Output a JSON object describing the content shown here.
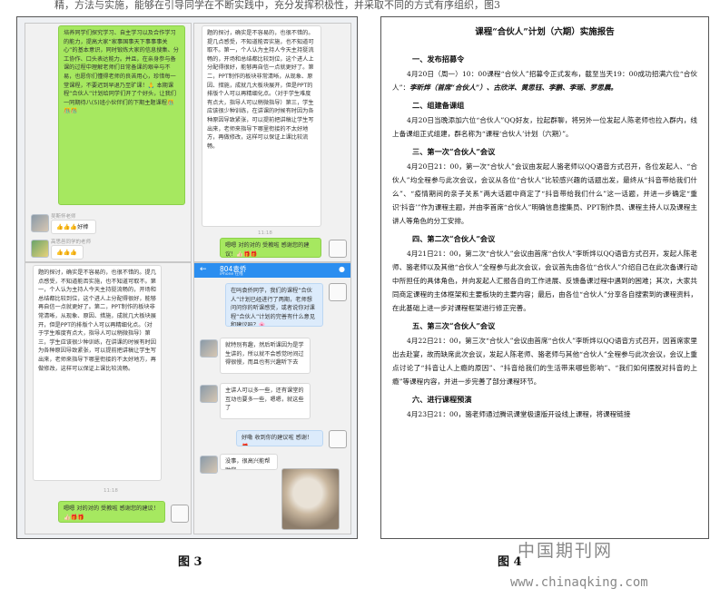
{
  "top_text": "精，方法与实施，能够在引导同学在不断实践中，充分发挥积极性，并采取不同的方式有序组织，图3",
  "figure3": {
    "caption": "图 3",
    "q1": {
      "main_bubble": "培养同学们探究学习、自主学习以及合作学习的能力，提高大家“家事国事天下事事事关心”的基本意识，同时锻炼大家的信息搜集、分工协作、口头表达能力。并且，在亲身参与备课的过程中理解老师们日常备课的艰辛与不易，也愿你们懂得老师的良苦用心，珍惜每一堂课程，不要迟到早退乃至旷课！🙏\n本期课程“合伙人”计划给同学们开了个好头，让我们一同期待八(5)班小伙伴们的下期主题课程🎊🎊🎊",
      "user1_name": "吴斯怀老师",
      "user1_msg": "👍👍👍好棒",
      "user2_name": "高思邑同学的老师",
      "user2_msg": "👍👍👍"
    },
    "q2": {
      "main_bubble": "题的探讨，确实是不容易的，也很不错的。提几点感受，不知道能否实施，也不知道可取不。第一，个人认为主持人今天主持挺流畅的，开场和总结都比较到位，这个进人上分配得很好，能够再自信一点就更好了。第二，PPT制作的板块非常清晰，从现象、原因、措施，成就几大板块展开，但是PPT的排版个人可以再精细化点。（对于学生难度有点大，指导人可以稍微指导）第三，学生应该很少种训练，在讲课的时候有时因为各种原因导致紧张，可以提前把讲稿让学生写出来，老师来指导下哪里衔接的不太好地方，再做修改，这样可以保证上课比较流畅。",
      "time": "11:18",
      "reply": "嗯嗯 对的对的 受教啦 感谢您的建议！👍🏻🎁🎁"
    },
    "q3": {
      "main_bubble": "题的探讨，确实是不容易的，也很不错的。提几点感受，不知道能否实施，也不知道可取不。第一，个人认为主持人今天主持挺流畅的，开场和总结都比较到位，这个进人上分配得很好，能够再自信一点就更好了。第二，PPT制作的板块非常清晰，从现象、原因、措施，成就几大板块展开，但是PPT的排版个人可以再精细化点。（对于学生难度有点大，指导人可以稍微指导）第三，学生应该很少种训练，在讲课的时候有时因为各种原因导致紧张，可以提前把讲稿让学生写出来，老师来指导下哪里衔接的不太好地方，再做修改，这样可以保证上课比较流畅。",
      "time": "11:18",
      "reply": "嗯嗯 对的对的 受教啦 感谢您的建议！👍🏻🎁🎁"
    },
    "q4": {
      "back_icon": "back-arrow-icon",
      "user_icon": "user-icon",
      "chat_title": "804袁侨",
      "chat_subtitle": "iPhone 在线",
      "msg1": "在吗袁侨同学，我们的课程“合伙人”计划已经进行了两期，老师想问问你的听课感受，或者说你对课程“合伙人”计划的完善有什么意见和建议吗？🌸",
      "msg2": "就特别有趣，然后听课因为是学生讲的，所以就不会感觉时间过得很慢，而且也有兴趣听下去",
      "msg3": "主讲人可以多一些，还有课堂的互动也要多一些，嗯嗯，就这些了",
      "msg4": "好嘞 收到你的建议啦 感谢！🎁",
      "msg5": "没事，很高兴能帮助您"
    }
  },
  "figure4": {
    "caption": "图 4",
    "title": "课程“合伙人”计划（六期）实施报告",
    "sections": [
      {
        "heading": "一、发布招募令",
        "text": "4月20日（周一）10：00课程“合伙人”招募令正式发布，截至当天19：00成功招满六位“合伙人”：",
        "names": "李昕烨（首席“合伙人”）、古欣洋、黄思钰、李鹏、李瑶、罗思晨。"
      },
      {
        "heading": "二、组建备课组",
        "text": "4月20日当晚添加六位“合伙人”QQ好友，拉起群聊，将另外一位发起人陈老师也拉入群内，线上备课组正式组建，群名称为“课程‘合伙人’计划（六期）”。",
        "names": ""
      },
      {
        "heading": "三、第一次“合伙人”会议",
        "text": "4月20日21：00，第一次“合伙人”会议由发起人骆老师以QQ语音方式召开，各位发起人、“合伙人”均全程参与此次会议，会议从各位“合伙人”比较感兴趣的话题出发，最终从“抖音带给我们什么”、“疫情期间的亲子关系”两大话题中商定了“抖音带给我们什么”这一话题，并进一步确定“重识‘抖音’”作为课程主题，并由李首席“合伙人”明确信息搜集员、PPT制作员、课程主持人以及课程主讲人等角色的分工安排。",
        "names": ""
      },
      {
        "heading": "四、第二次“合伙人”会议",
        "text": "4月21日21：00，第二次“合伙人”会议由首席“合伙人”李昕烨以QQ语音方式召开，发起人陈老师、骆老师以及其他“合伙人”全程参与此次会议，会议首先由各位“合伙人”介绍自己在此次备课行动中所担任的具体角色，并向发起人汇报各自的工作进展、反馈备课过程中遇到的困难；其次，大家共同商定课程的主体框架和主要板块的主要内容；最后，由各位“合伙人”分享各自搜索到的课程资料，在此基础上进一步对课程框架进行修正完善。",
        "names": ""
      },
      {
        "heading": "五、第三次“合伙人”会议",
        "text": "4月22日21：00，第三次“合伙人”会议由首席“合伙人”李昕烨以QQ语音方式召开，因首席家里出去赴宴，故而缺席此次会议，发起人陈老师、骆老师与其他“合伙人”全程参与此次会议，会议上重点讨论了“抖音让人上瘾的原因”、“抖音给我们的生活带来哪些影响”、“我们如何摆脱对抖音的上瘾”等课程内容，并进一步完善了部分课程环节。",
        "names": ""
      },
      {
        "heading": "六、进行课程预演",
        "text": "4月23日21：00，骆老师通过腾讯课堂极速版开设线上课程，将课程链接",
        "names": ""
      }
    ]
  },
  "watermark": {
    "cn": "中国期刊网",
    "url": "www.chinaqking.com"
  }
}
